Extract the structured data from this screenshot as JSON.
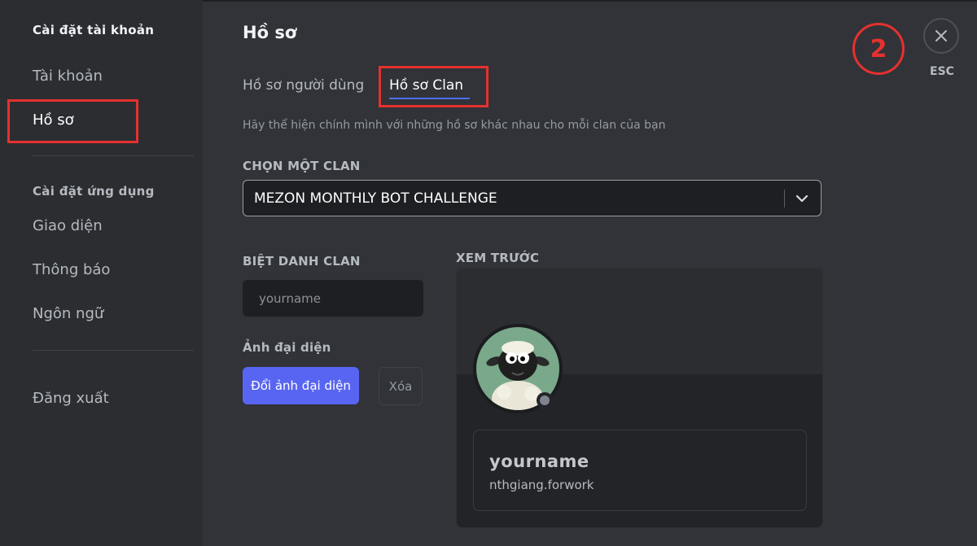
{
  "sidebar": {
    "account_settings_title": "Cài đặt tài khoản",
    "account_items": [
      {
        "label": "Tài khoản"
      },
      {
        "label": "Hồ sơ"
      }
    ],
    "app_settings_title": "Cài đặt ứng dụng",
    "app_items": [
      {
        "label": "Giao diện"
      },
      {
        "label": "Thông báo"
      },
      {
        "label": "Ngôn ngữ"
      }
    ],
    "logout_label": "Đăng xuất"
  },
  "main": {
    "title": "Hồ sơ",
    "tabs": [
      {
        "label": "Hồ sơ người dùng"
      },
      {
        "label": "Hồ sơ Clan"
      }
    ],
    "description": "Hãy thể hiện chính mình với những hồ sơ khác nhau cho mỗi clan của bạn",
    "clan_select": {
      "label": "CHỌN MỘT CLAN",
      "value": "MEZON MONTHLY BOT CHALLENGE"
    },
    "nickname": {
      "label": "BIỆT DANH CLAN",
      "placeholder": "yourname"
    },
    "avatar_section": {
      "label": "Ảnh đại diện",
      "change_button": "Đổi ảnh đại diện",
      "remove_button": "Xóa"
    },
    "preview": {
      "label": "XEM TRƯỚC",
      "display_name": "yourname",
      "username": "nthgiang.forwork"
    }
  },
  "close": {
    "esc_label": "ESC"
  },
  "annotation": {
    "step_number": "2",
    "color": "#e5312f"
  },
  "colors": {
    "accent": "#5865f2",
    "tab_underline": "#4e6fff",
    "sidebar_bg": "#2b2d31",
    "main_bg": "#313338"
  }
}
